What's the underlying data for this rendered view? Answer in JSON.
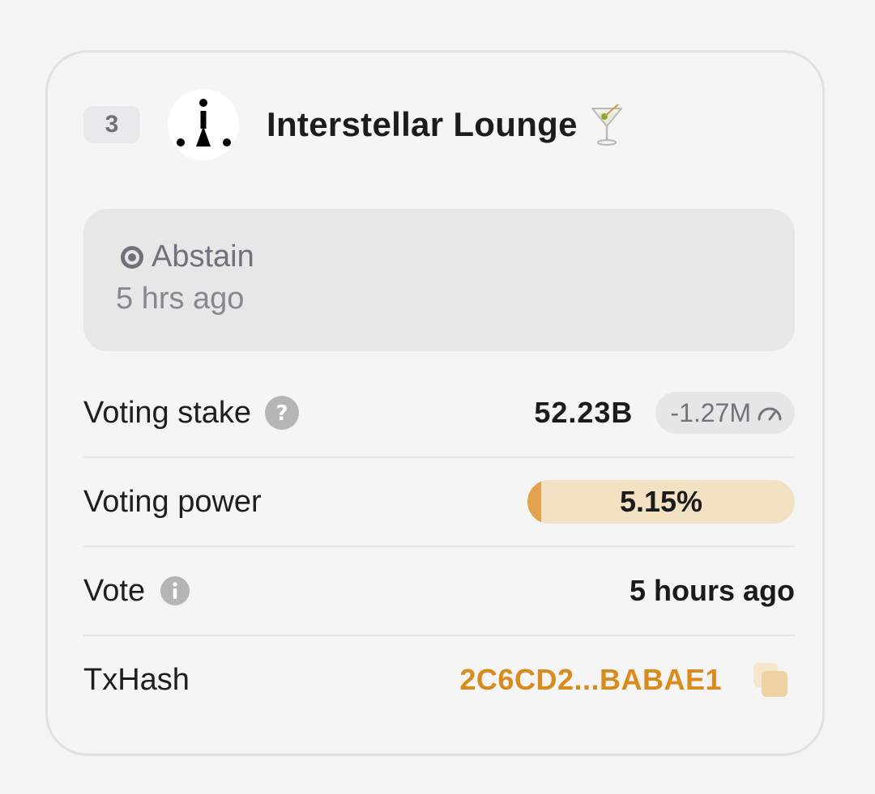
{
  "validator": {
    "rank": "3",
    "name": "Interstellar Lounge",
    "emoji_icon": "martini-glass-icon",
    "avatar_icon": "interstellar-logo-icon"
  },
  "vote": {
    "option": "Abstain",
    "option_icon": "target-icon",
    "time_ago": "5 hrs ago"
  },
  "details": {
    "voting_stake": {
      "label": "Voting stake",
      "value": "52.23B",
      "change": "-1.27M",
      "help_icon": "question-icon",
      "change_icon": "gauge-icon"
    },
    "voting_power": {
      "label": "Voting power",
      "value": "5.15%",
      "fraction": 0.0515
    },
    "vote_time": {
      "label": "Vote",
      "value": "5 hours ago",
      "info_icon": "info-icon"
    },
    "tx_hash": {
      "label": "TxHash",
      "value": "2C6CD2...BABAE1",
      "copy_icon": "copy-icon"
    }
  },
  "colors": {
    "accent": "#d98b1c",
    "power_bar_bg": "#f3e1c4",
    "power_bar_fill": "#e3a24d"
  }
}
